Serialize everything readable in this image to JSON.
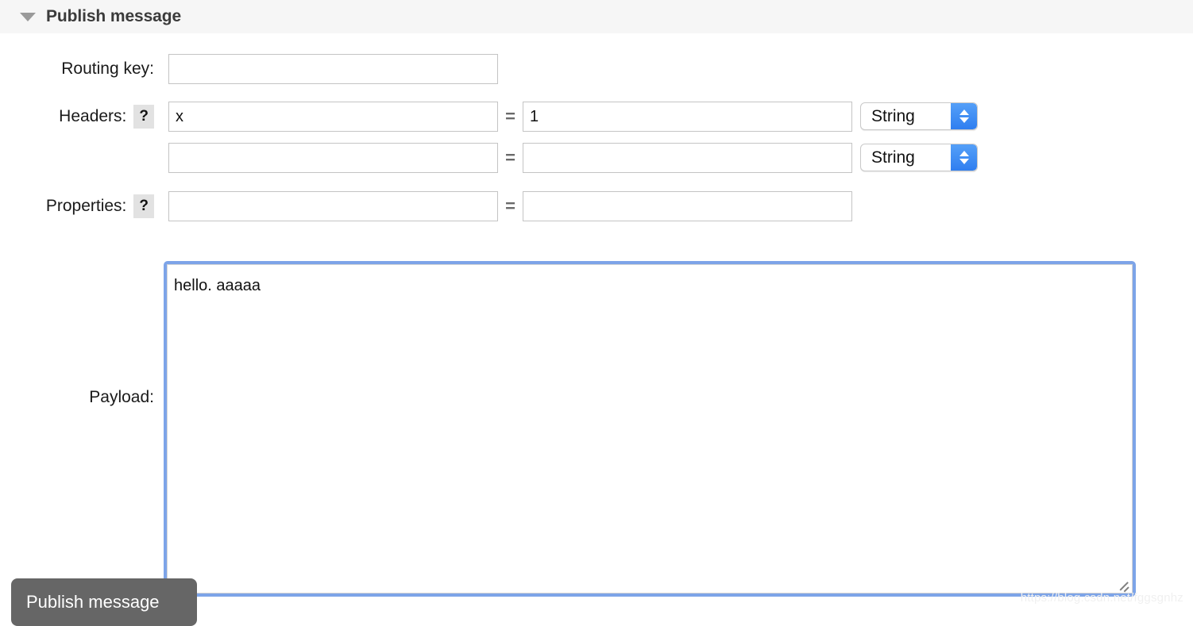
{
  "section": {
    "title": "Publish message",
    "collapse_icon": "triangle-down-icon"
  },
  "fields": {
    "routing_key": {
      "label": "Routing key:",
      "value": "",
      "placeholder": ""
    },
    "headers": {
      "label": "Headers:",
      "help": "?",
      "rows": [
        {
          "key": "x",
          "eq": "=",
          "value": "1",
          "type": "String"
        },
        {
          "key": "",
          "eq": "=",
          "value": "",
          "type": "String"
        }
      ]
    },
    "properties": {
      "label": "Properties:",
      "help": "?",
      "rows": [
        {
          "key": "",
          "eq": "=",
          "value": ""
        }
      ]
    },
    "payload": {
      "label": "Payload:",
      "value": "hello. aaaaa"
    }
  },
  "actions": {
    "publish_label": "Publish message"
  },
  "watermark": "https://blog.csdn.net/fggsgnhz",
  "colors": {
    "header_bg": "#f6f6f6",
    "focus_border": "#7da4e8",
    "select_accent": "#2f7ef0",
    "button_bg": "#666666"
  }
}
